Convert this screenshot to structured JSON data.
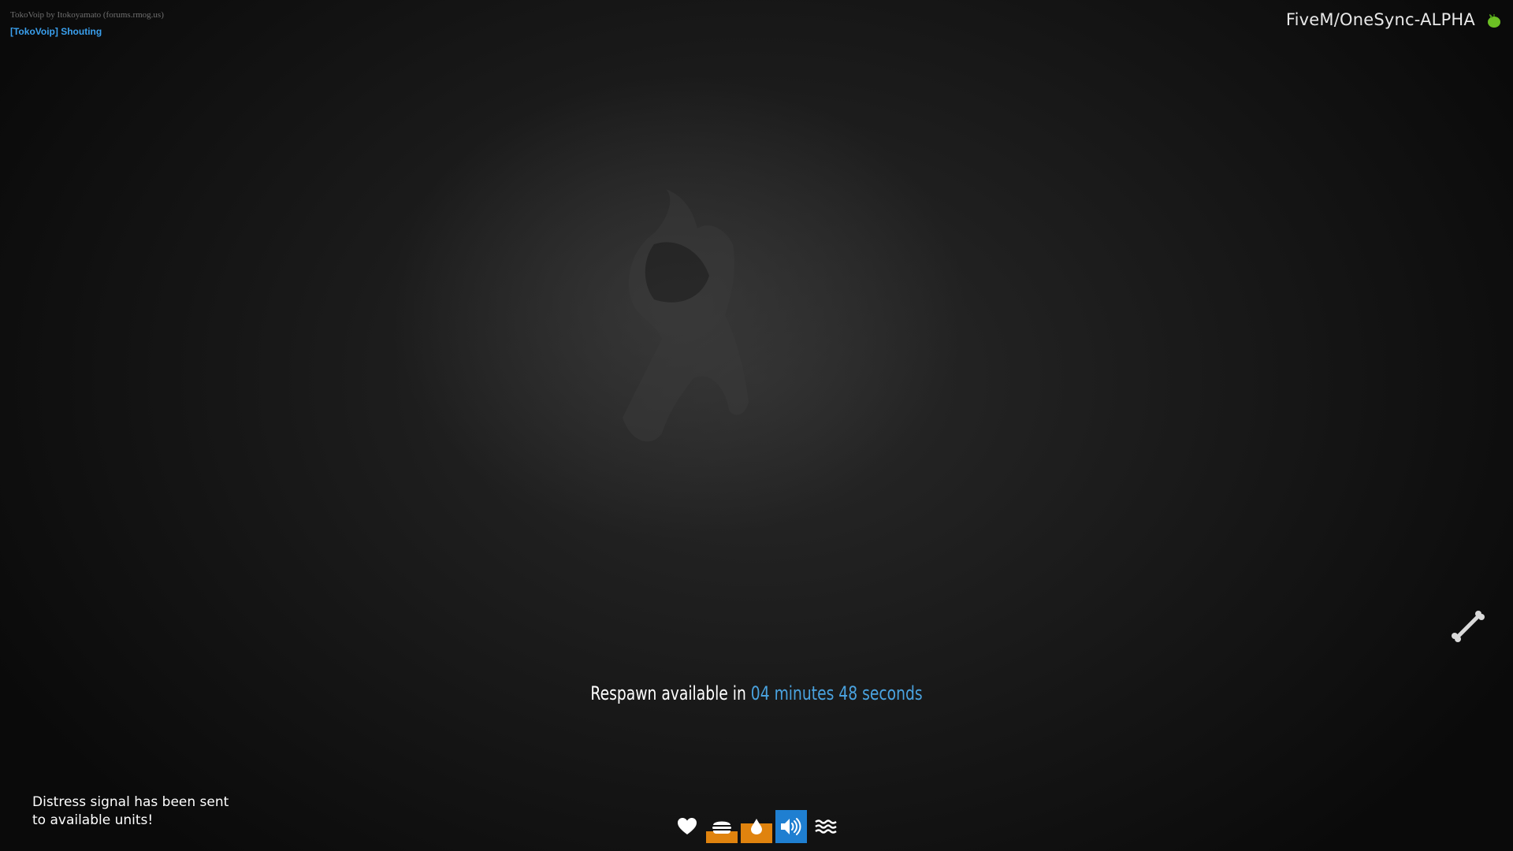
{
  "voip": {
    "credit": "TokoVoip by Itokoyamato (forums.rmog.us)",
    "mode": "[TokoVoip] Shouting"
  },
  "server": {
    "name": "FiveM/OneSync-ALPHA",
    "icon": "green-fruit-icon"
  },
  "respawn": {
    "prefix": "Respawn available in",
    "time": "04 minutes 48 seconds",
    "time_color": "#4aa3e0"
  },
  "notification": {
    "line1": "Distress signal has been sent",
    "line2": "to available units!"
  },
  "status": {
    "items": [
      {
        "name": "health",
        "icon": "heart-icon",
        "level": 1.0,
        "color": "none"
      },
      {
        "name": "hunger",
        "icon": "burger-icon",
        "level": 0.35,
        "color": "#e0830e"
      },
      {
        "name": "thirst",
        "icon": "water-drop-icon",
        "level": 0.6,
        "color": "#e0830e"
      },
      {
        "name": "voice",
        "icon": "speaker-icon",
        "level": 1.0,
        "color": "#1f7fd1"
      },
      {
        "name": "stamina",
        "icon": "wave-icon",
        "level": 1.0,
        "color": "none"
      }
    ]
  },
  "injury": {
    "icon": "bone-icon"
  }
}
